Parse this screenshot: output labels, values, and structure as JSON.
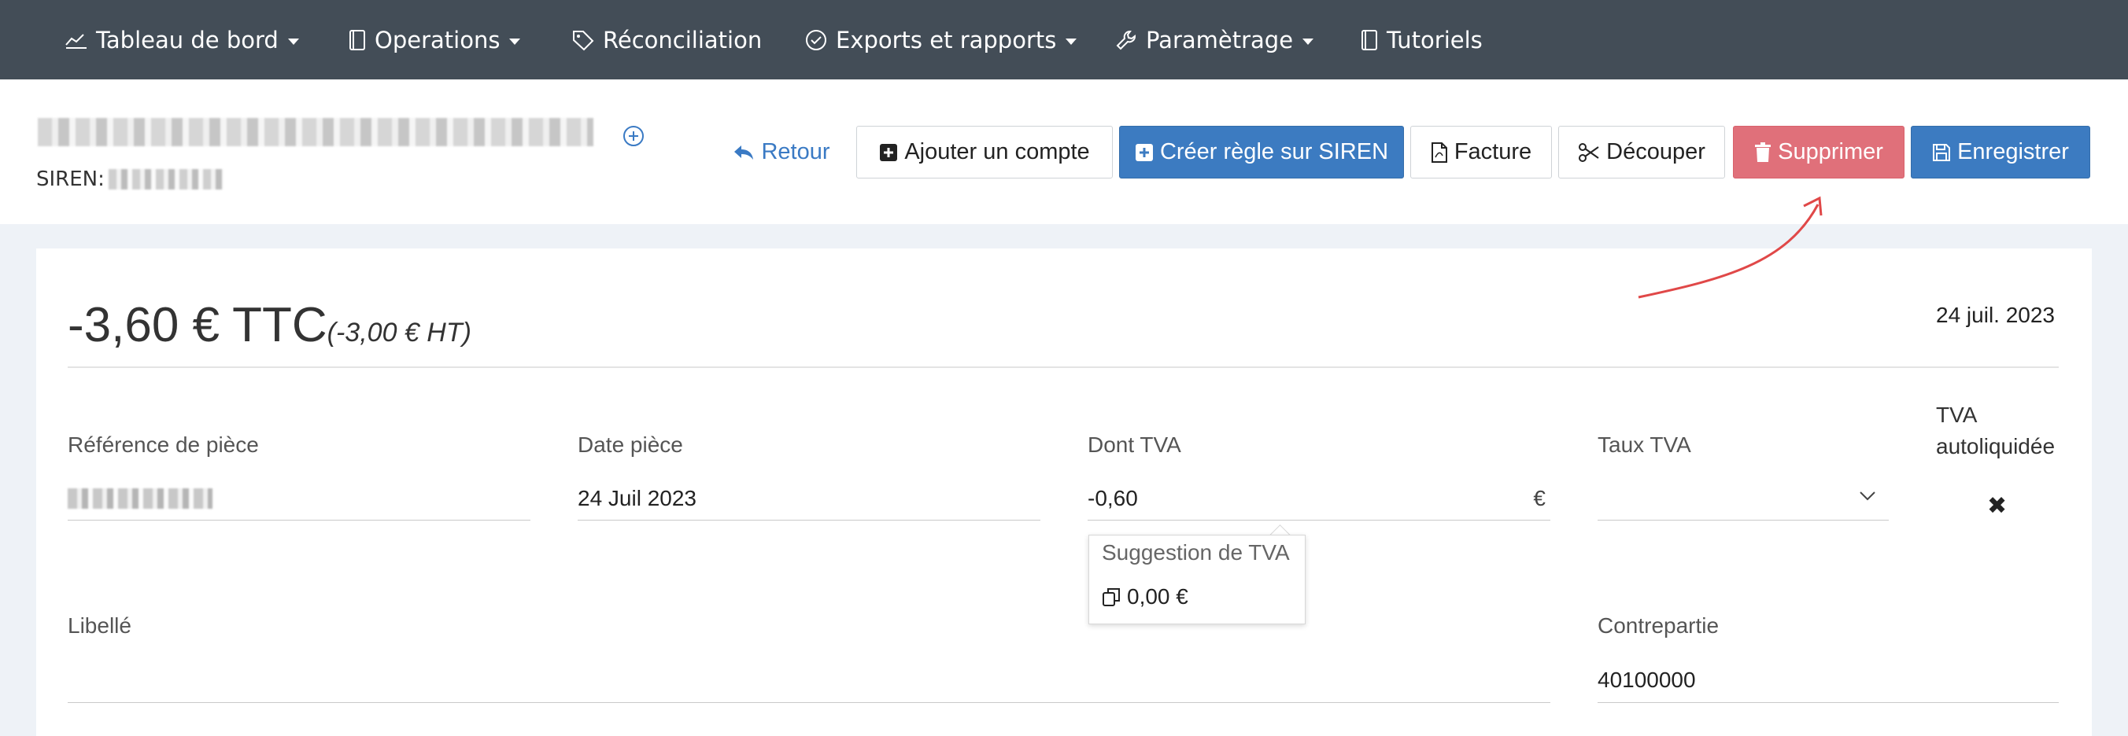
{
  "nav": {
    "items": [
      {
        "label": "Tableau de bord",
        "icon": "chart-line-icon",
        "dropdown": true
      },
      {
        "label": "Operations",
        "icon": "book-icon",
        "dropdown": true
      },
      {
        "label": "Réconciliation",
        "icon": "tag-icon",
        "dropdown": false
      },
      {
        "label": "Exports et rapports",
        "icon": "check-circle-icon",
        "dropdown": true
      },
      {
        "label": "Paramètrage",
        "icon": "wrench-icon",
        "dropdown": true
      },
      {
        "label": "Tutoriels",
        "icon": "book-icon",
        "dropdown": false
      }
    ]
  },
  "header": {
    "siren_label": "SIREN:",
    "add_icon": "plus-circle-icon"
  },
  "toolbar": {
    "back_label": "Retour",
    "add_account_label": "Ajouter un compte",
    "create_rule_label": "Créer règle sur SIREN",
    "invoice_label": "Facture",
    "split_label": "Découper",
    "delete_label": "Supprimer",
    "save_label": "Enregistrer"
  },
  "colors": {
    "nav_bg": "#434d57",
    "primary": "#3c7bc1",
    "danger": "#e0707a",
    "annotation_arrow": "#e04848"
  },
  "transaction": {
    "amount_ttc": "-3,60 € TTC",
    "amount_ht": "(-3,00 € HT)",
    "date": "24 juil. 2023"
  },
  "form": {
    "reference_label": "Référence de pièce",
    "date_label": "Date pièce",
    "date_value": "24 Juil 2023",
    "vat_label": "Dont TVA",
    "vat_value": "-0,60",
    "vat_currency": "€",
    "vat_rate_label": "Taux TVA",
    "vat_rate_value": "",
    "reverse_charge_label": "TVA autoliquidée",
    "reverse_charge_value": "✖",
    "libelle_label": "Libellé",
    "libelle_value": "",
    "counterpart_label": "Contrepartie",
    "counterpart_value": "40100000"
  },
  "vat_suggestion": {
    "title": "Suggestion de TVA",
    "value": "0,00 €"
  }
}
